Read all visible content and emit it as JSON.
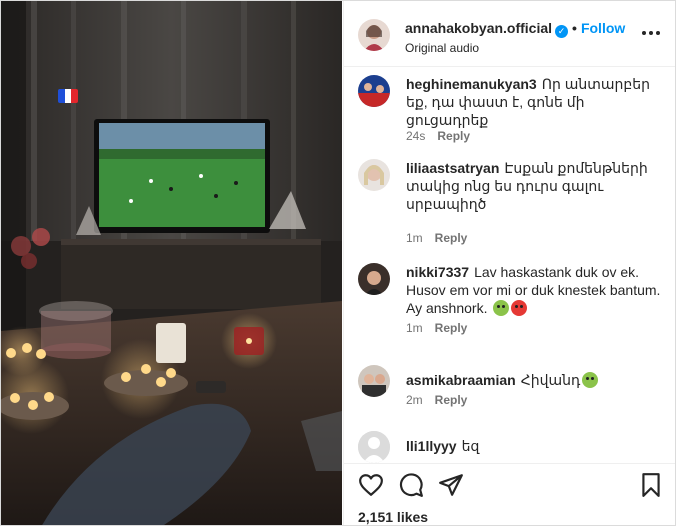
{
  "post": {
    "username": "annahakobyan.official",
    "verified": true,
    "separator": "•",
    "follow_label": "Follow",
    "audio_label": "Original audio",
    "likes": "2,151 likes"
  },
  "colors": {
    "accent": "#0095f6",
    "text": "#262626",
    "muted": "#737373",
    "flag": [
      "#1f4fd8",
      "#ffffff",
      "#e3262c"
    ]
  },
  "comments": [
    {
      "username": "heghinemanukyan3",
      "text": "Որ անտարբեր եք, դա փաստ է, գոնե մի ցուցադրեք",
      "time": "24s",
      "reply": "Reply"
    },
    {
      "username": "liliaastsatryan",
      "text": "Էսքան քոմենթների տակից ոնց ես դուրս գալու սրբապիղծ",
      "time": "1m",
      "reply": "Reply"
    },
    {
      "username": "nikki7337",
      "text": "Lav haskastank duk ov ek. Husov em vor mi or duk knestek bantum. Ay anshnork.",
      "time": "1m",
      "reply": "Reply",
      "emojis": [
        "green-face",
        "red-angry-face"
      ]
    },
    {
      "username": "asmikabraamian",
      "text": "Հիվանդ",
      "time": "2m",
      "reply": "Reply",
      "emojis": [
        "green-face"
      ]
    },
    {
      "username": "lli1llyyy",
      "text": "եզ"
    }
  ],
  "icons": [
    "more-options-icon",
    "like-heart-icon",
    "comment-icon",
    "share-icon",
    "save-bookmark-icon"
  ]
}
